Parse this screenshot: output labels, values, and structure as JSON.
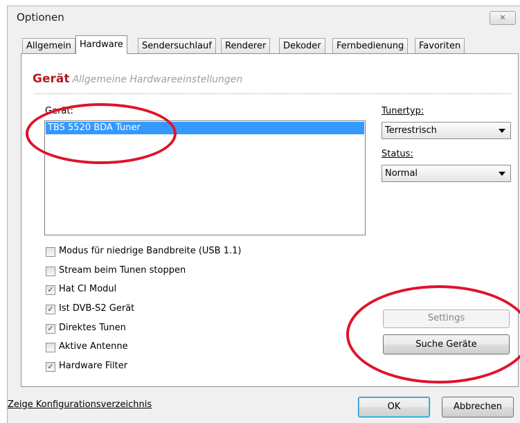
{
  "window": {
    "title": "Optionen",
    "close_glyph": "✕"
  },
  "tabs": [
    {
      "label": "Allgemein",
      "active": false
    },
    {
      "label": "Hardware",
      "active": true
    },
    {
      "label": "Sendersuchlauf",
      "active": false
    },
    {
      "label": "Renderer",
      "active": false
    },
    {
      "label": "Dekoder",
      "active": false
    },
    {
      "label": "Fernbedienung",
      "active": false
    },
    {
      "label": "Favoriten",
      "active": false
    }
  ],
  "section": {
    "title": "Gerät",
    "subtitle": "Allgemeine Hardwareeinstellungen"
  },
  "device": {
    "label": "Gerät:",
    "items": [
      "TBS 5520 BDA Tuner"
    ]
  },
  "tunertyp": {
    "label": "Tunertyp:",
    "value": "Terrestrisch"
  },
  "status": {
    "label": "Status:",
    "value": "Normal"
  },
  "options": [
    {
      "label": "Modus für niedrige Bandbreite (USB 1.1)",
      "checked": false
    },
    {
      "label": "Stream beim Tunen stoppen",
      "checked": false
    },
    {
      "label": "Hat CI Modul",
      "checked": true
    },
    {
      "label": "Ist DVB-S2 Gerät",
      "checked": true
    },
    {
      "label": "Direktes Tunen",
      "checked": true
    },
    {
      "label": "Aktive Antenne",
      "checked": false
    },
    {
      "label": "Hardware Filter",
      "checked": true
    }
  ],
  "buttons": {
    "settings": "Settings",
    "search": "Suche Geräte",
    "ok": "OK",
    "cancel": "Abbrechen"
  },
  "footer_link": "Zeige Konfigurationsverzeichnis",
  "check_glyph": "✓",
  "annotation_color": "#e0122b"
}
